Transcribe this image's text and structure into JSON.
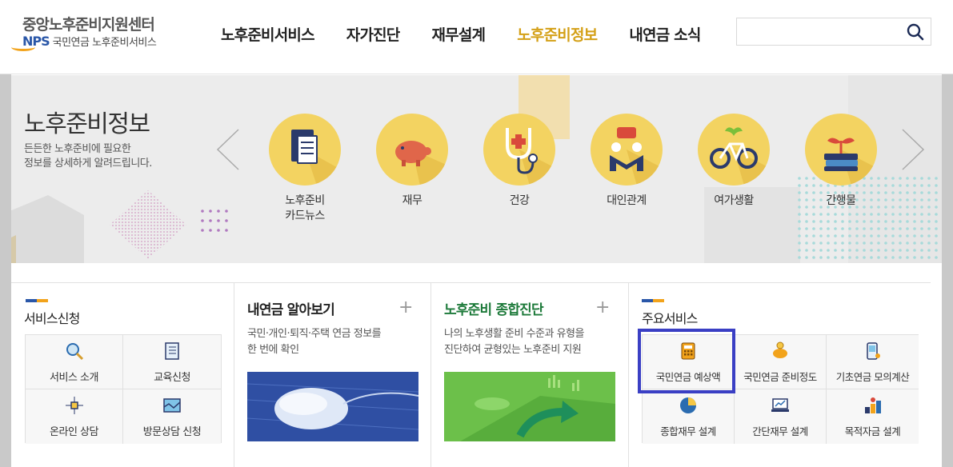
{
  "header": {
    "logo_title": "중앙노후준비지원센터",
    "logo_brand": "NPS",
    "logo_sub": "국민연금 노후준비서비스",
    "nav": [
      {
        "label": "노후준비서비스",
        "active": false
      },
      {
        "label": "자가진단",
        "active": false
      },
      {
        "label": "재무설계",
        "active": false
      },
      {
        "label": "노후준비정보",
        "active": true
      },
      {
        "label": "내연금 소식",
        "active": false
      }
    ],
    "search_placeholder": "",
    "search_value": ""
  },
  "banner": {
    "title": "노후준비정보",
    "desc_line1": "든든한 노후준비에 필요한",
    "desc_line2": "정보를 상세하게 알려드립니다.",
    "categories": [
      {
        "label1": "노후준비",
        "label2": "카드뉴스",
        "icon": "card-news-icon"
      },
      {
        "label1": "재무",
        "label2": "",
        "icon": "piggy-bank-icon"
      },
      {
        "label1": "건강",
        "label2": "",
        "icon": "stethoscope-icon"
      },
      {
        "label1": "대인관계",
        "label2": "",
        "icon": "people-chat-icon"
      },
      {
        "label1": "여가생활",
        "label2": "",
        "icon": "bicycle-icon"
      },
      {
        "label1": "간행물",
        "label2": "",
        "icon": "books-sprout-icon"
      }
    ]
  },
  "service_apply": {
    "title": "서비스신청",
    "items": [
      {
        "label": "서비스 소개",
        "icon": "magnifier-icon"
      },
      {
        "label": "교육신청",
        "icon": "notebook-icon"
      },
      {
        "label": "온라인 상담",
        "icon": "network-icon"
      },
      {
        "label": "방문상담 신청",
        "icon": "map-icon"
      }
    ]
  },
  "card_pension": {
    "title": "내연금 알아보기",
    "desc_line1": "국민·개인·퇴직·주택 연금 정보를",
    "desc_line2": "한 번에 확인"
  },
  "card_diagnosis": {
    "title": "노후준비 종합진단",
    "desc_line1": "나의 노후생활 준비 수준과 유형을",
    "desc_line2": "진단하여 균형있는 노후준비 지원"
  },
  "main_services": {
    "title": "주요서비스",
    "items": [
      {
        "label": "국민연금 예상액",
        "icon": "calculator-icon"
      },
      {
        "label": "국민연금 준비정도",
        "icon": "piggy-coin-icon"
      },
      {
        "label": "기초연금 모의계산",
        "icon": "phone-touch-icon"
      },
      {
        "label": "종합재무 설계",
        "icon": "pie-chart-icon"
      },
      {
        "label": "간단재무 설계",
        "icon": "laptop-chart-icon"
      },
      {
        "label": "목적자금 설계",
        "icon": "coins-bags-icon"
      }
    ]
  },
  "colors": {
    "accent": "#d4a017",
    "circle": "#f3d361",
    "highlight_box": "#3a3fc4",
    "brand_blue": "#2a57a8"
  }
}
